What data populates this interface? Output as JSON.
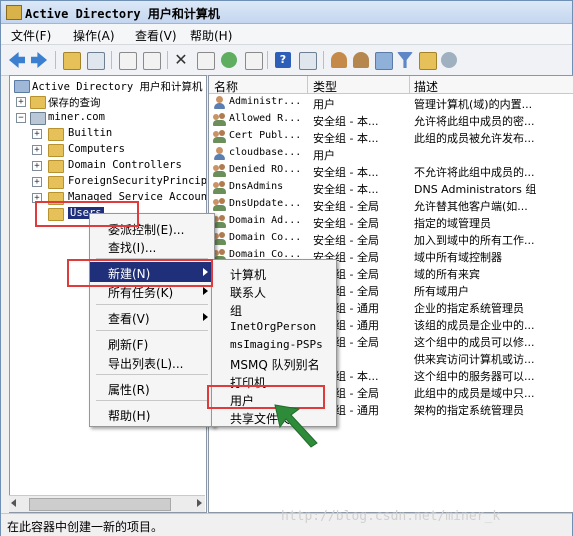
{
  "window": {
    "title": "Active Directory 用户和计算机"
  },
  "menubar": [
    "文件(F)",
    "操作(A)",
    "查看(V)",
    "帮助(H)"
  ],
  "tree": {
    "root": "Active Directory 用户和计算机",
    "saved_queries": "保存的查询",
    "domain": "miner.com",
    "children": [
      "Builtin",
      "Computers",
      "Domain Controllers",
      "ForeignSecurityPrincip",
      "Managed Service Accoun",
      "Users"
    ]
  },
  "list": {
    "headers": [
      "名称",
      "类型",
      "描述"
    ],
    "rows": [
      {
        "name": "Administr...",
        "type": "用户",
        "desc": "管理计算机(域)的内置..."
      },
      {
        "name": "Allowed R...",
        "type": "安全组 - 本...",
        "desc": "允许将此组中成员的密..."
      },
      {
        "name": "Cert Publ...",
        "type": "安全组 - 本...",
        "desc": "此组的成员被允许发布..."
      },
      {
        "name": "cloudbase...",
        "type": "用户",
        "desc": ""
      },
      {
        "name": "Denied RO...",
        "type": "安全组 - 本...",
        "desc": "不允许将此组中成员的..."
      },
      {
        "name": "DnsAdmins",
        "type": "安全组 - 本...",
        "desc": "DNS Administrators 组"
      },
      {
        "name": "DnsUpdate...",
        "type": "安全组 - 全局",
        "desc": "允许替其他客户端(如..."
      },
      {
        "name": "Domain Ad...",
        "type": "安全组 - 全局",
        "desc": "指定的域管理员"
      },
      {
        "name": "Domain Co...",
        "type": "安全组 - 全局",
        "desc": "加入到域中的所有工作..."
      },
      {
        "name": "Domain Co...",
        "type": "安全组 - 全局",
        "desc": "域中所有域控制器"
      },
      {
        "name": "",
        "type": "安全组 - 全局",
        "desc": "域的所有来宾"
      },
      {
        "name": "",
        "type": "安全组 - 全局",
        "desc": "所有域用户"
      },
      {
        "name": "",
        "type": "安全组 - 通用",
        "desc": "企业的指定系统管理员"
      },
      {
        "name": "",
        "type": "安全组 - 通用",
        "desc": "该组的成员是企业中的..."
      },
      {
        "name": "",
        "type": "安全组 - 全局",
        "desc": "这个组中的成员可以修..."
      },
      {
        "name": "",
        "type": "",
        "desc": "供来宾访问计算机或访..."
      },
      {
        "name": "",
        "type": "安全组 - 本...",
        "desc": "这个组中的服务器可以..."
      },
      {
        "name": "",
        "type": "安全组 - 全局",
        "desc": "此组中的成员是域中只..."
      },
      {
        "name": "",
        "type": "安全组 - 通用",
        "desc": "架构的指定系统管理员"
      }
    ]
  },
  "context_menu": [
    "委派控制(E)...",
    "查找(I)...",
    "新建(N)",
    "所有任务(K)",
    "查看(V)",
    "刷新(F)",
    "导出列表(L)...",
    "属性(R)",
    "帮助(H)"
  ],
  "submenu": [
    "计算机",
    "联系人",
    "组",
    "InetOrgPerson",
    "msImaging-PSPs",
    "MSMQ 队列别名",
    "打印机",
    "用户",
    "共享文件夹"
  ],
  "status": "在此容器中创建一新的项目。",
  "watermark": "http://blog.csdn.net/miner_k",
  "colors": {
    "highlight": "#1f2f7a",
    "annotation": "#e03b3b",
    "arrow": "#2e8b3a"
  }
}
